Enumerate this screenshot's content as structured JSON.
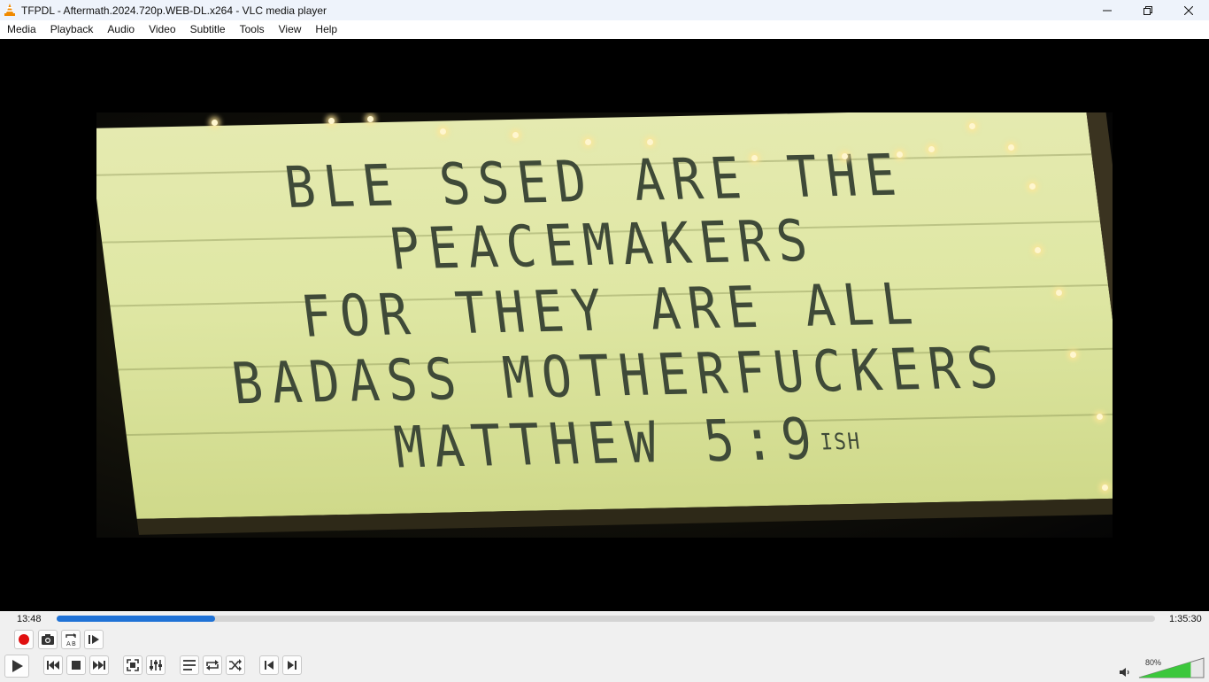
{
  "window": {
    "title": "TFPDL - Aftermath.2024.720p.WEB-DL.x264 - VLC media player"
  },
  "menu": [
    "Media",
    "Playback",
    "Audio",
    "Video",
    "Subtitle",
    "Tools",
    "View",
    "Help"
  ],
  "video_frame": {
    "sign_lines": [
      "BLE SSED ARE THE",
      "PEACEMAKERS",
      "FOR THEY ARE ALL",
      "BADASS MOTHERFUCKERS",
      "MATTHEW 5:9"
    ],
    "sign_suffix": "ISH"
  },
  "playback": {
    "elapsed": "13:48",
    "total": "1:35:30",
    "progress_fraction": 0.144
  },
  "volume": {
    "label": "80%",
    "level_fraction": 0.8
  },
  "colors": {
    "accent": "#1f72d6",
    "record": "#e01010",
    "volume_fill": "#3cc73c"
  }
}
